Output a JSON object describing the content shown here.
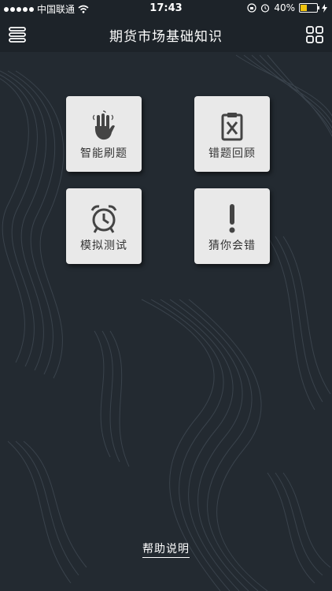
{
  "status_bar": {
    "carrier": "中国联通",
    "time": "17:43",
    "battery_percent": "40%",
    "battery_level": 0.4
  },
  "navbar": {
    "title": "期货市场基础知识",
    "left_icon": "menu-icon",
    "right_icon": "grid-icon"
  },
  "tiles": [
    {
      "label": "智能刷题",
      "icon": "hand-icon"
    },
    {
      "label": "错题回顾",
      "icon": "clipboard-x-icon"
    },
    {
      "label": "模拟测试",
      "icon": "alarm-clock-icon"
    },
    {
      "label": "猜你会错",
      "icon": "exclamation-icon"
    }
  ],
  "help_link": "帮助说明",
  "colors": {
    "background": "#232a31",
    "bar": "#1d2329",
    "tile": "#e9e9e9",
    "icon": "#444444",
    "battery": "#f1c40f"
  }
}
